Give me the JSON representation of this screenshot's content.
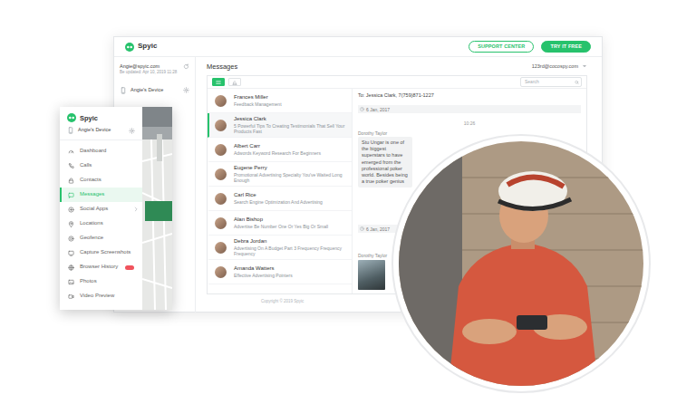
{
  "brand": "Spyic",
  "header_buttons": [
    {
      "label": "SUPPORT CENTER",
      "kind": "outline"
    },
    {
      "label": "TRY IT FREE",
      "kind": "solid"
    }
  ],
  "account": {
    "email": "Angie@spyic.com",
    "updated": "Be updated: Apr 10, 2019 11:28",
    "device": "Angie's Device"
  },
  "messages": {
    "title": "Messages",
    "account": "123rd@cocospy.com",
    "views": [
      {
        "selected": true
      },
      {
        "selected": false
      }
    ],
    "search": {
      "placeholder": "Search"
    },
    "conversations": [
      {
        "name": "Frances Miller",
        "preview": "Feedback Management",
        "selected": false
      },
      {
        "name": "Jessica Clark",
        "preview": "5 Powerful Tips To Creating Testimonials That Sell Your Products Fast",
        "selected": true
      },
      {
        "name": "Albert Carr",
        "preview": "Adwords Keyword Research For Beginners",
        "selected": false
      },
      {
        "name": "Eugene Perry",
        "preview": "Promotional Advertising Specialty You've Waited Long Enough",
        "selected": false
      },
      {
        "name": "Carl Rice",
        "preview": "Search Engine Optimization And Advertising",
        "selected": false
      },
      {
        "name": "Alan Bishop",
        "preview": "Advertise Be Number One Or Yes Big Or Small",
        "selected": false
      },
      {
        "name": "Debra Jordan",
        "preview": "Advertising On A Budget Part 3 Frequency Frequency Frequency",
        "selected": false
      },
      {
        "name": "Amanda Watters",
        "preview": "Effective Advertising Pointers",
        "selected": false
      }
    ],
    "thread": {
      "to": "To: Jessica Clark, 7(759)871-1227",
      "entries": [
        {
          "kind": "date",
          "text": "6 Jan, 2017"
        },
        {
          "kind": "time",
          "text": "10:26"
        },
        {
          "kind": "message",
          "sender": "Dorothy Taylor",
          "text": "Stu Ungar is one of the biggest superstars to have emerged from the professional poker world. Besides being a true poker genius"
        },
        {
          "kind": "date",
          "text": "6 Jan, 2017"
        },
        {
          "kind": "photo",
          "sender": "Dorothy Taylor"
        }
      ]
    },
    "footer": "Copyright © 2019 Spyic"
  },
  "drawer": {
    "brand": "Spyic",
    "device": "Angie's Device",
    "items": [
      {
        "label": "Dashboard",
        "selected": false,
        "expandable": false,
        "badge": false
      },
      {
        "label": "Calls",
        "selected": false,
        "expandable": false,
        "badge": false
      },
      {
        "label": "Contacts",
        "selected": false,
        "expandable": false,
        "badge": false
      },
      {
        "label": "Messages",
        "selected": true,
        "expandable": false,
        "badge": false
      },
      {
        "label": "Social Apps",
        "selected": false,
        "expandable": true,
        "badge": false
      },
      {
        "label": "Locations",
        "selected": false,
        "expandable": false,
        "badge": false
      },
      {
        "label": "Geofence",
        "selected": false,
        "expandable": false,
        "badge": false
      },
      {
        "label": "Capture Screenshots",
        "selected": false,
        "expandable": false,
        "badge": false
      },
      {
        "label": "Browser History",
        "selected": false,
        "expandable": false,
        "badge": true
      },
      {
        "label": "Photos",
        "selected": false,
        "expandable": false,
        "badge": false
      },
      {
        "label": "Video Preview",
        "selected": false,
        "expandable": false,
        "badge": false
      }
    ]
  }
}
